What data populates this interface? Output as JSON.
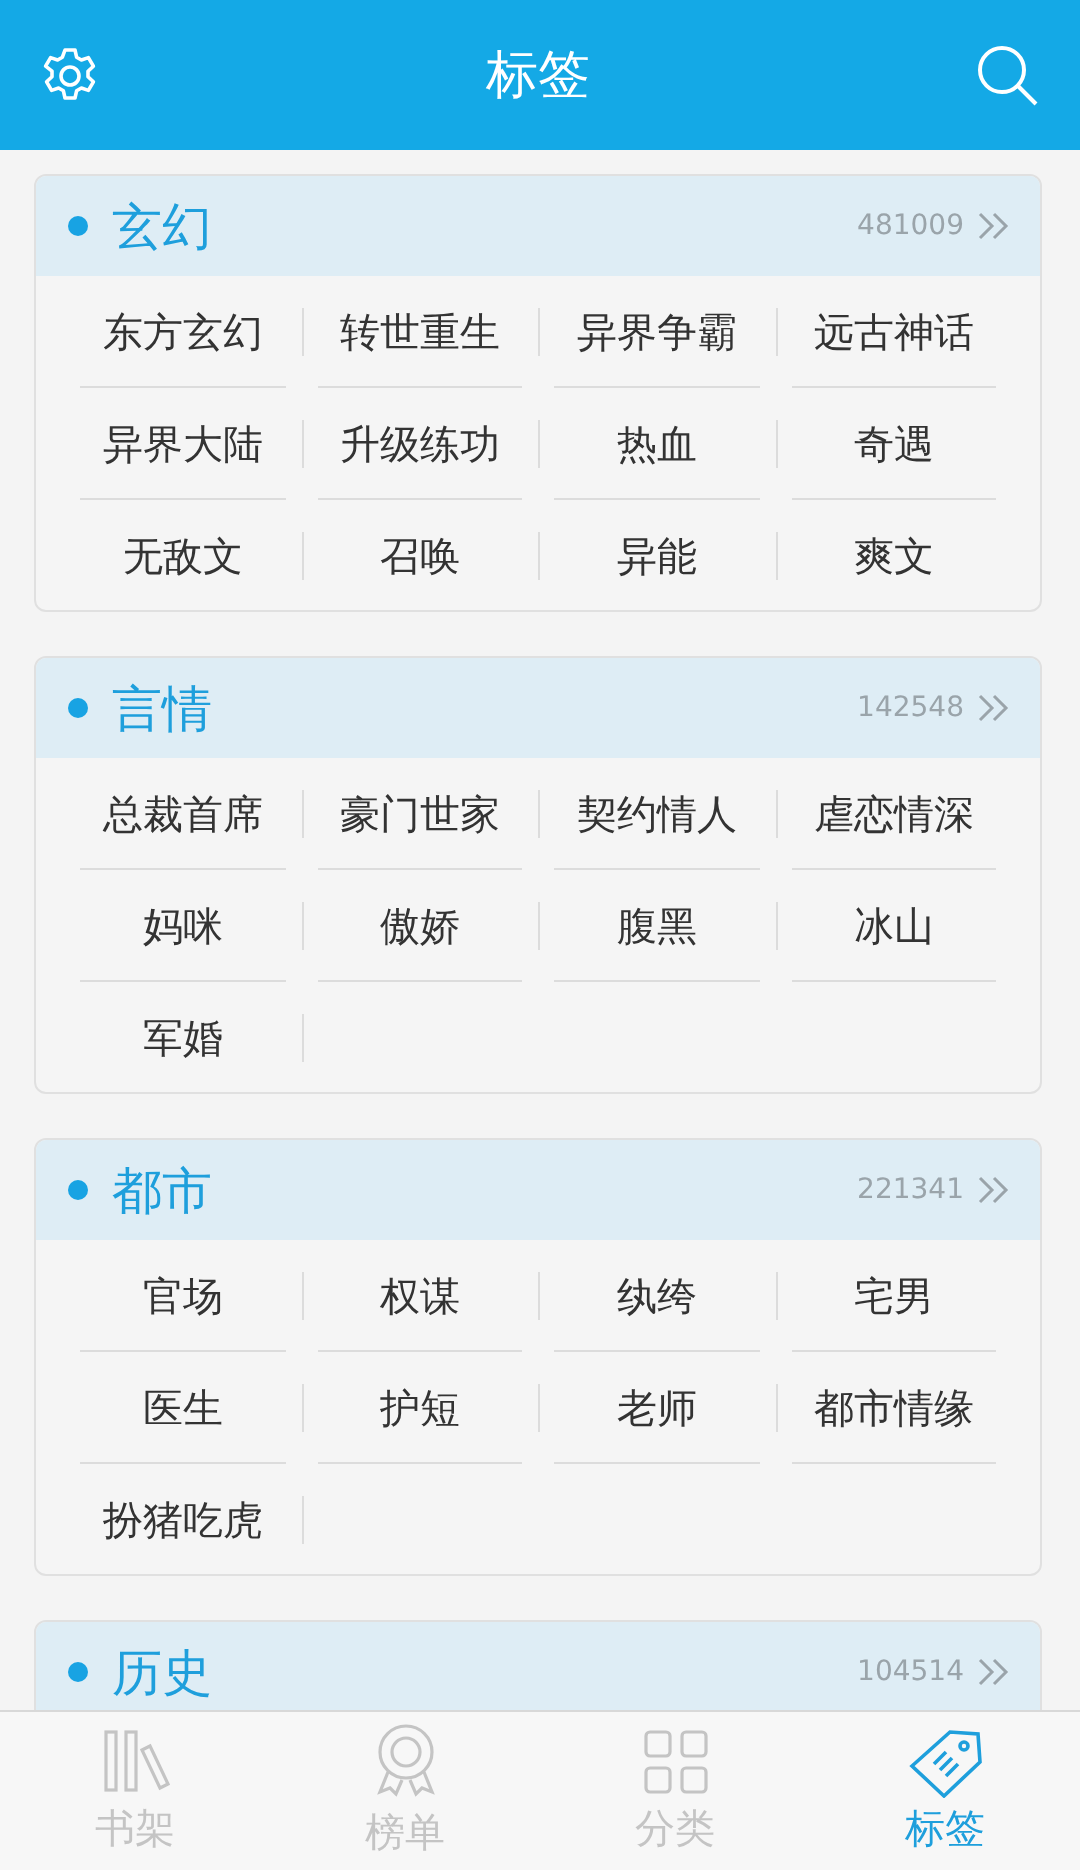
{
  "top_bar": {
    "title": "标签"
  },
  "sections": [
    {
      "title": "玄幻",
      "count": "481009",
      "tags": [
        "东方玄幻",
        "转世重生",
        "异界争霸",
        "远古神话",
        "异界大陆",
        "升级练功",
        "热血",
        "奇遇",
        "无敌文",
        "召唤",
        "异能",
        "爽文"
      ]
    },
    {
      "title": "言情",
      "count": "142548",
      "tags": [
        "总裁首席",
        "豪门世家",
        "契约情人",
        "虐恋情深",
        "妈咪",
        "傲娇",
        "腹黑",
        "冰山",
        "军婚"
      ]
    },
    {
      "title": "都市",
      "count": "221341",
      "tags": [
        "官场",
        "权谋",
        "纨绔",
        "宅男",
        "医生",
        "护短",
        "老师",
        "都市情缘",
        "扮猪吃虎"
      ]
    },
    {
      "title": "历史",
      "count": "104514"
    }
  ],
  "tab_bar": [
    {
      "kind": "shelf",
      "label": "书架",
      "selected": false
    },
    {
      "kind": "rank",
      "label": "榜单",
      "selected": false
    },
    {
      "kind": "category",
      "label": "分类",
      "selected": false
    },
    {
      "kind": "tag",
      "label": "标签",
      "selected": true
    }
  ]
}
